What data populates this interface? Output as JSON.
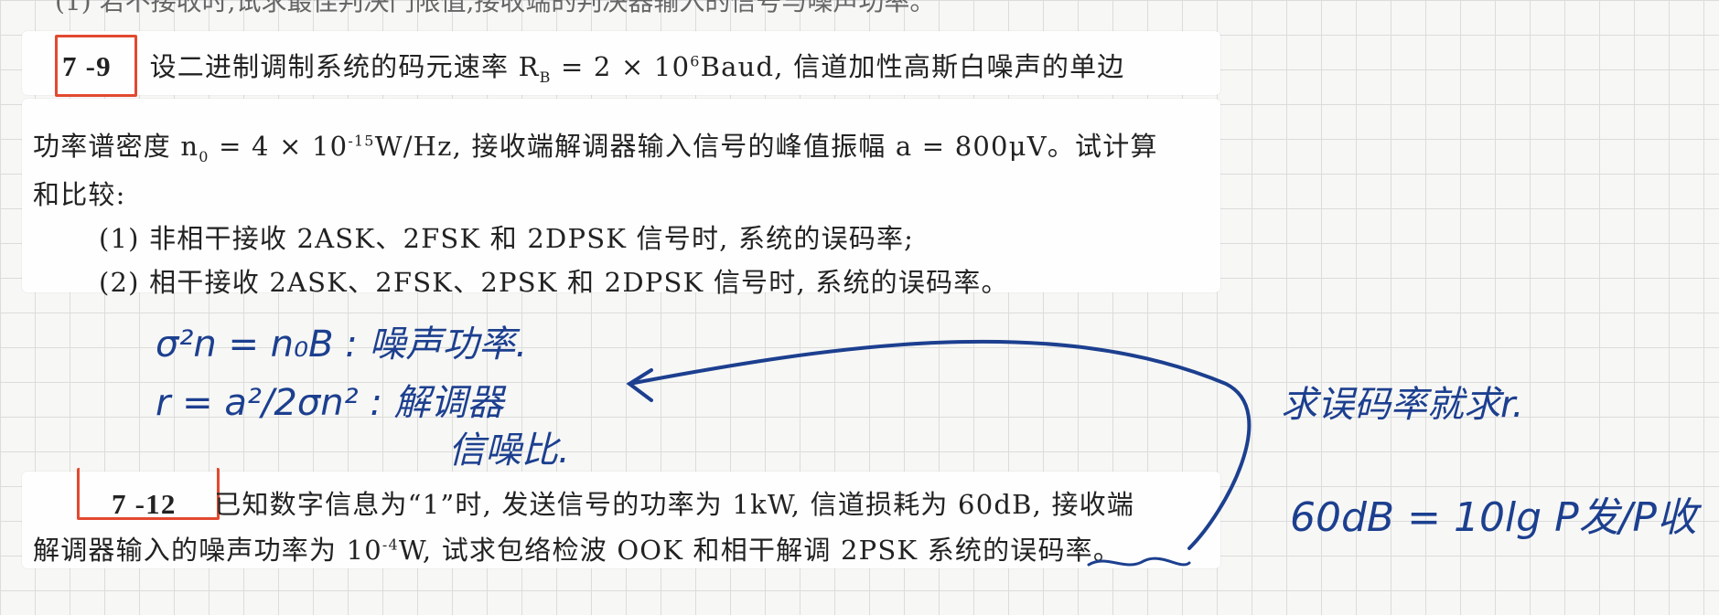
{
  "prev_fragment": "(1) 若不接收时,试求最佳判决门限值,接收端的判决器输入的信号与噪声功率。",
  "p79": {
    "number": "7 -9",
    "line1": "设二进制调制系统的码元速率 R",
    "line1_sub": "B",
    "line1_b": " = 2 × 10",
    "line1_sup": "6",
    "line1_c": "Baud, 信道加性高斯白噪声的单边",
    "line2": "功率谱密度 n",
    "line2_sub": "0",
    "line2_b": " = 4 × 10",
    "line2_sup": "-15",
    "line2_c": "W/Hz, 接收端解调器输入信号的峰值振幅 a = 800μV。试计算",
    "line3": "和比较:",
    "item1": "(1) 非相干接收 2ASK、2FSK 和 2DPSK 信号时, 系统的误码率;",
    "item2": "(2) 相干接收 2ASK、2FSK、2PSK 和 2DPSK 信号时, 系统的误码率。"
  },
  "p712": {
    "number": "7 -12",
    "line1": "已知数字信息为“1”时, 发送信号的功率为 1kW, 信道损耗为 60dB, 接收端",
    "line2": "解调器输入的噪声功率为 10",
    "line2_sup": "-4",
    "line2_b": "W, 试求包络检波 OOK 和相干解调 2PSK 系统的误码率。"
  },
  "notes": {
    "n1": "σ²n = n₀B : 噪声功率.",
    "n2": "r = a²/2σn² : 解调器",
    "n3": "信噪比.",
    "n4": "求误码率就求r.",
    "n5": "60dB = 10lg P发/P收"
  },
  "colors": {
    "box": "#e2492f",
    "ink": "#1c3f8f"
  }
}
